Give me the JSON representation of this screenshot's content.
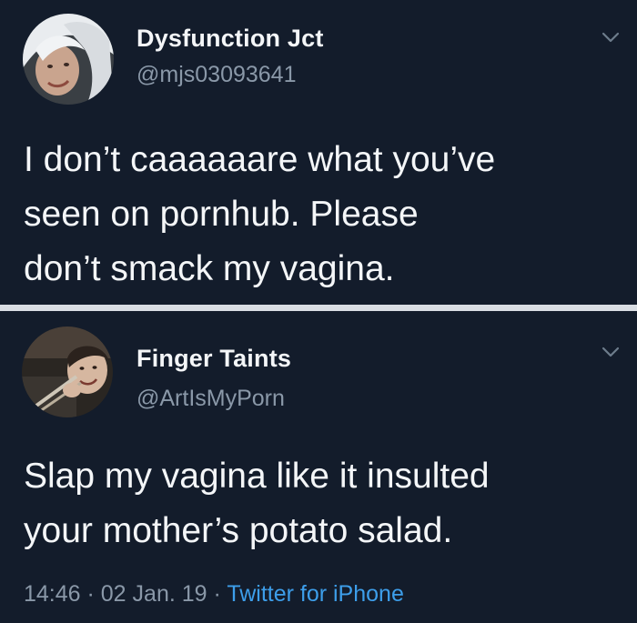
{
  "tweets": [
    {
      "display_name": "Dysfunction Jct",
      "handle": "@mjs03093641",
      "text": "I don’t caaaaaare what you’ve\nseen on pornhub.  Please\ndon’t smack my vagina."
    },
    {
      "display_name": "Finger Taints",
      "handle": "@ArtIsMyPorn",
      "text": "Slap my vagina like it insulted\nyour mother’s potato salad.",
      "time": "14:46",
      "sep1": " · ",
      "date": "02 Jan. 19",
      "sep2": " · ",
      "source": "Twitter for iPhone"
    }
  ],
  "icons": {
    "chevron": "chevron-down-icon",
    "avatar": "avatar"
  },
  "colors": {
    "background": "#131c2b",
    "text": "#f4f6f8",
    "secondary_text": "#8a98a8",
    "link": "#3d9eea",
    "divider": "#d9dde3"
  }
}
